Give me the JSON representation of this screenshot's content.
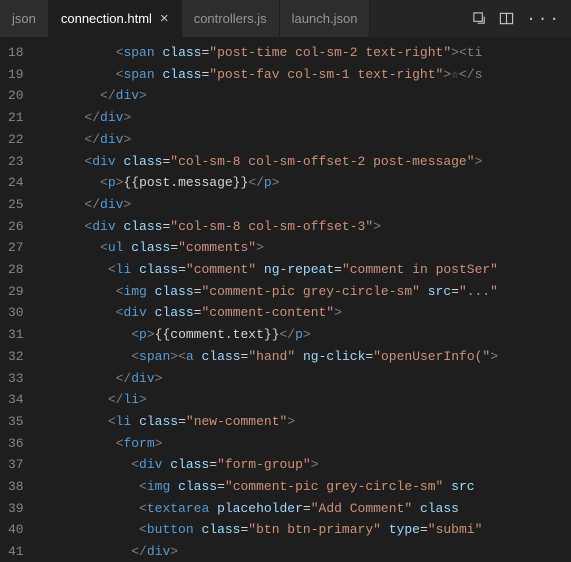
{
  "tabs": {
    "left": "json",
    "active": "connection.html",
    "t2": "controllers.js",
    "t3": "launch.json"
  },
  "gutter": [
    "18",
    "19",
    "20",
    "21",
    "22",
    "23",
    "24",
    "25",
    "26",
    "27",
    "28",
    "29",
    "30",
    "31",
    "32",
    "33",
    "34",
    "35",
    "36",
    "37",
    "38",
    "39",
    "40",
    "41"
  ],
  "code": {
    "l18": {
      "ind": 10,
      "tag": "span",
      "attrs": [
        [
          "class",
          "post-time col-sm-2 text-right"
        ]
      ],
      "tail": "><ti"
    },
    "l19": {
      "ind": 10,
      "tag": "span",
      "attrs": [
        [
          "class",
          "post-fav col-sm-1 text-right"
        ]
      ],
      "tail": ">☆</s"
    },
    "l20": {
      "ind": 8,
      "close": "div"
    },
    "l21": {
      "ind": 6,
      "close": "div"
    },
    "l22": {
      "ind": 6,
      "close": "div"
    },
    "l23": {
      "ind": 6,
      "tag": "div",
      "attrs": [
        [
          "class",
          "col-sm-8 col-sm-offset-2 post-message"
        ]
      ],
      "tail": ">"
    },
    "l24": {
      "ind": 8,
      "tag": "p",
      "tail": ">",
      "text": "{{post.message}}",
      "closeInline": "p"
    },
    "l25": {
      "ind": 6,
      "close": "div"
    },
    "l26": {
      "ind": 6,
      "tag": "div",
      "attrs": [
        [
          "class",
          "col-sm-8 col-sm-offset-3"
        ]
      ],
      "tail": ">"
    },
    "l27": {
      "ind": 8,
      "tag": "ul",
      "attrs": [
        [
          "class",
          "comments"
        ]
      ],
      "tail": ">"
    },
    "l28": {
      "ind": 9,
      "tag": "li",
      "attrs": [
        [
          "class",
          "comment"
        ],
        [
          "ng-repeat",
          "comment in postSer"
        ]
      ],
      "tail": ""
    },
    "l29": {
      "ind": 10,
      "tag": "img",
      "attrs": [
        [
          "class",
          "comment-pic grey-circle-sm"
        ],
        [
          "src",
          "..."
        ]
      ],
      "tail": ""
    },
    "l30": {
      "ind": 10,
      "tag": "div",
      "attrs": [
        [
          "class",
          "comment-content"
        ]
      ],
      "tail": ">"
    },
    "l31": {
      "ind": 12,
      "tag": "p",
      "tail": ">",
      "text": "{{comment.text}}",
      "closeInline": "p"
    },
    "l32": {
      "ind": 12,
      "tag": "span",
      "tail": ">",
      "then": {
        "tag": "a",
        "attrs": [
          [
            "class",
            "hand"
          ],
          [
            "ng-click",
            "openUserInfo("
          ]
        ]
      }
    },
    "l33": {
      "ind": 10,
      "close": "div"
    },
    "l34": {
      "ind": 9,
      "close": "li"
    },
    "l35": {
      "ind": 9,
      "tag": "li",
      "attrs": [
        [
          "class",
          "new-comment"
        ]
      ],
      "tail": ">"
    },
    "l36": {
      "ind": 10,
      "tag": "form",
      "tail": ">"
    },
    "l37": {
      "ind": 12,
      "tag": "div",
      "attrs": [
        [
          "class",
          "form-group"
        ]
      ],
      "tail": ">"
    },
    "l38": {
      "ind": 13,
      "tag": "img",
      "attrs": [
        [
          "class",
          "comment-pic grey-circle-sm"
        ],
        [
          "srcPartial",
          "src"
        ]
      ],
      "tail": ""
    },
    "l39": {
      "ind": 13,
      "tag": "textarea",
      "attrs": [
        [
          "placeholder",
          "Add Comment"
        ],
        [
          "classPartial",
          "class"
        ]
      ],
      "tail": ""
    },
    "l40": {
      "ind": 13,
      "tag": "button",
      "attrs": [
        [
          "class",
          "btn btn-primary"
        ],
        [
          "type",
          "submi"
        ]
      ],
      "tail": ""
    },
    "l41": {
      "ind": 12,
      "close": "div"
    }
  }
}
